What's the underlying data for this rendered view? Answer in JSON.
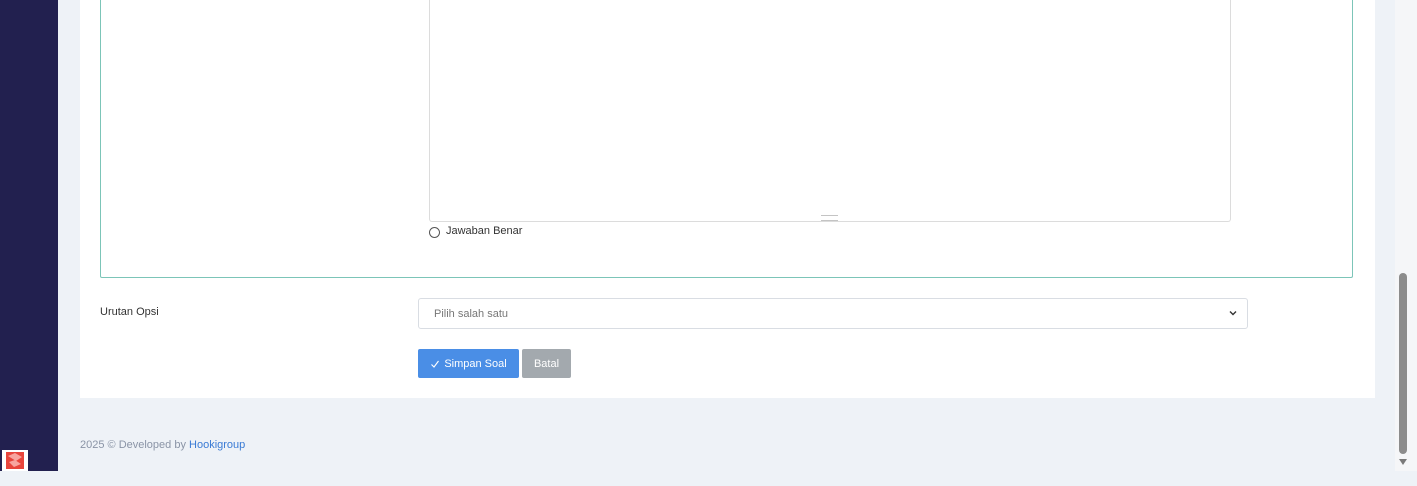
{
  "form": {
    "radio_label": "Jawaban Benar",
    "order_label": "Urutan Opsi",
    "order_select": {
      "value": "Pilih salah satu"
    },
    "save_label": "Simpan Soal",
    "cancel_label": "Batal"
  },
  "footer": {
    "prefix": "2025 © Developed by",
    "link": "Hookigroup"
  },
  "colors": {
    "sidebar": "#22204f",
    "primary_button": "#4a8ee6",
    "secondary_button": "#a3a9ae",
    "option_border": "#7cc5b8"
  },
  "icons": [
    "check-icon",
    "chevron-down-icon",
    "brand-logo-icon",
    "scroll-down-arrow-icon"
  ]
}
